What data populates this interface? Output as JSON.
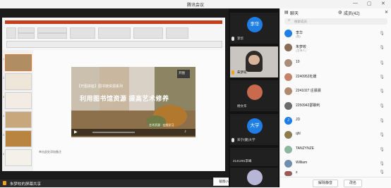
{
  "window": {
    "title": "腾讯会议"
  },
  "share_bar": {
    "presenter_label": "朱梦皎的屏幕共享"
  },
  "tooltip": {
    "text": "截图(Alt + A)"
  },
  "ppt": {
    "slide_title": "利用图书馆资源 提高艺术修养",
    "slide_subtitle": "【开图讲座】图书馆资源系列",
    "slide_seal": "开图",
    "slide_caption": "艺术资源 · 在线学习",
    "notes_hint": "单击此处添加备注",
    "thumb_numbers": [
      "1",
      "2",
      "3",
      "4",
      "5",
      "6"
    ]
  },
  "videos": [
    {
      "name": "李华",
      "avatar": "李华",
      "color": "#1e7ee6",
      "type": "avatar"
    },
    {
      "name": "朱梦皎",
      "type": "camera"
    },
    {
      "name": "杨文华",
      "type": "photo"
    },
    {
      "name": "宋宁(健)大学",
      "avatar": "大学",
      "color": "#1e7ee6",
      "type": "avatar"
    },
    {
      "name": "2141291李峰",
      "type": "blank"
    },
    {
      "name": "",
      "type": "photo2"
    }
  ],
  "panel": {
    "tab_chat": "聊天",
    "tab_members": "成员(42)",
    "search_placeholder": "搜索成员",
    "members": [
      {
        "name": "李华",
        "sub": "(我)",
        "color": "#1e7ee6",
        "initial": "李华"
      },
      {
        "name": "朱梦皎",
        "sub": "(主持人)",
        "color": "#8a6b55",
        "initial": ""
      },
      {
        "name": "10",
        "sub": "",
        "color": "#a88d7a",
        "initial": ""
      },
      {
        "name": "2240952杜媛",
        "sub": "",
        "color": "#c4826b",
        "initial": ""
      },
      {
        "name": "2241027 庄晨晨",
        "sub": "",
        "color": "#b08a70",
        "initial": ""
      },
      {
        "name": "2250942邵聊利",
        "sub": "",
        "color": "#6c6c6c",
        "initial": ""
      },
      {
        "name": "JD",
        "sub": "",
        "color": "#1e7ee6",
        "initial": "J"
      },
      {
        "name": "qhl",
        "sub": "",
        "color": "#8e7b4f",
        "initial": ""
      },
      {
        "name": "TANZYNZE",
        "sub": "",
        "color": "#8db6a0",
        "initial": ""
      },
      {
        "name": "William",
        "sub": "",
        "color": "#6f8fae",
        "initial": ""
      },
      {
        "name": "z",
        "sub": "",
        "color": "#9b5a5a",
        "initial": ""
      }
    ],
    "btn_unmute_all": "解除静音",
    "btn_rename": "改名"
  }
}
